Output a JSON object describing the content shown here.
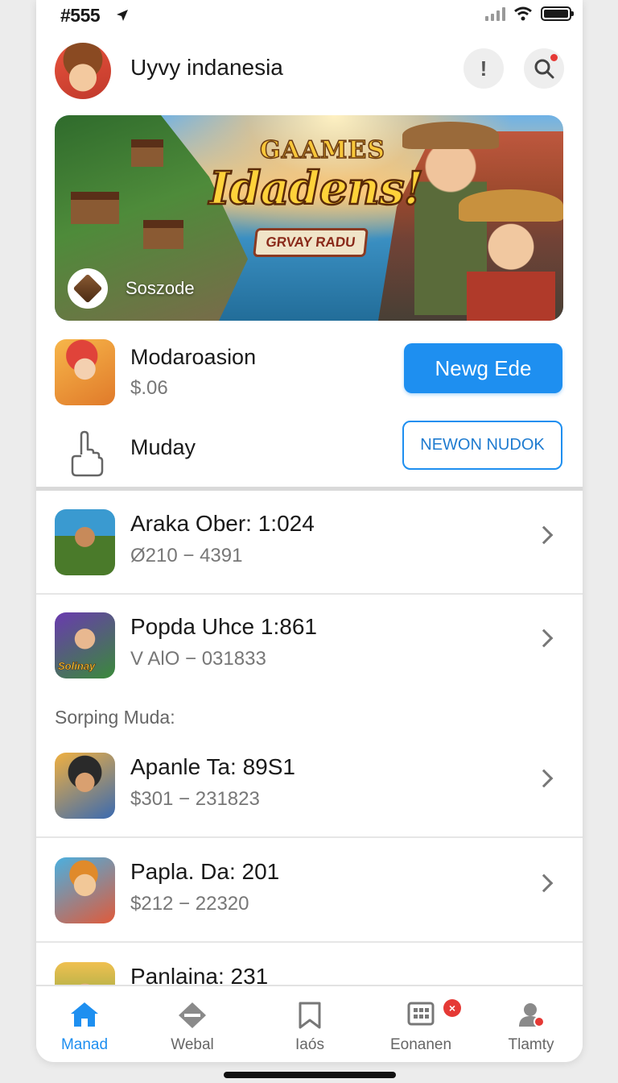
{
  "status_bar": {
    "time": "#555"
  },
  "header": {
    "title": "Uyvy indanesia",
    "info_glyph": "!"
  },
  "banner": {
    "title_top": "GAAMES",
    "title": "Idadens!",
    "ribbon": "GRVAY RADU",
    "caption": "Soszode"
  },
  "featured": [
    {
      "name": "Modaroasion",
      "sub": "$.06",
      "button": "Newg Ede"
    },
    {
      "name": "Muday",
      "button": "NEWON NUDOK"
    }
  ],
  "list_top": [
    {
      "title": "Araka Ober: 1:024",
      "sub": "Ø210 − 4391"
    },
    {
      "title": "Popda Uhce 1:861",
      "sub": "V AlO − 031833"
    }
  ],
  "section_label": "Sorping Muda:",
  "list_bottom": [
    {
      "title": "Apanle Ta: 89S1",
      "sub": "$301 − 231823"
    },
    {
      "title": "Papla. Da: 201",
      "sub": "$212 − 22320"
    },
    {
      "title": "Panlaina: 231",
      "sub": ""
    }
  ],
  "icon_labels": {
    "popda": "Solinay"
  },
  "tabs": [
    {
      "label": "Manad",
      "icon": "home-icon",
      "active": true
    },
    {
      "label": "Webal",
      "icon": "diamond-icon"
    },
    {
      "label": "Iaós",
      "icon": "bookmark-icon"
    },
    {
      "label": "Eonanen",
      "icon": "grid-icon",
      "badge": "×"
    },
    {
      "label": "Tlamty",
      "icon": "user-icon"
    }
  ],
  "colors": {
    "accent": "#1e8ff0",
    "badge": "#e53935"
  }
}
